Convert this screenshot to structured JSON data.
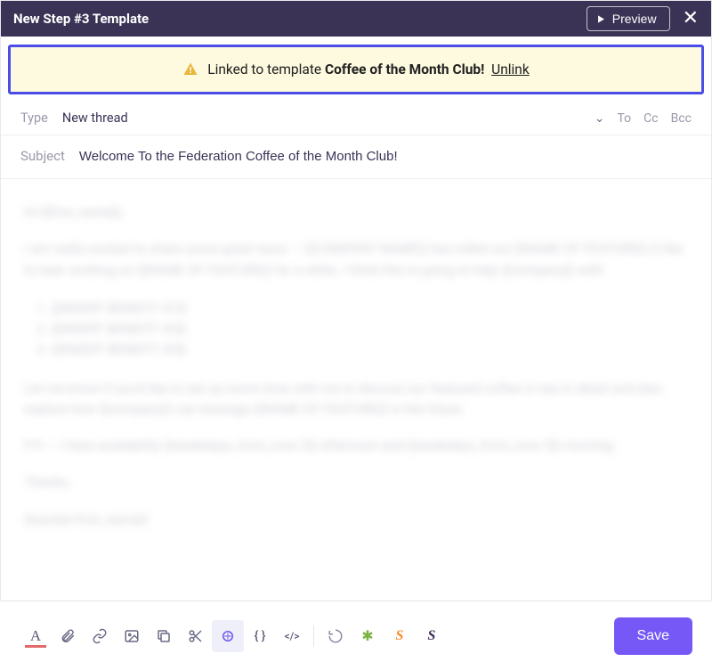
{
  "topbar": {
    "title": "New Step #3 Template",
    "preview": "Preview"
  },
  "alert": {
    "prefix": "Linked to template ",
    "template_name": "Coffee of the Month Club!",
    "unlink": "Unlink"
  },
  "fields": {
    "type_label": "Type",
    "type_value": "New thread",
    "to": "To",
    "cc": "Cc",
    "bcc": "Bcc",
    "subject_label": "Subject",
    "subject_value": "Welcome To the Federation Coffee of the Month Club!"
  },
  "body": {
    "greeting": "Hi {{first_name}},",
    "p1": "I am really excited to share some great news — {{COMPANY NAME}} has rolled out {{NAME OF FEATURE}} (I like to hear working on {{NAME OF FEATURE}} for a while. I think this is going to help {{company}} with:",
    "b1": "{{INSERT BENEFIT #1}}",
    "b2": "{{INSERT BENEFIT #2}}",
    "b3": "{{INSERT BENEFIT #3}}",
    "p2": "Let me know if you'd like to set up some time with me to discuss our featured coffee or tea in detail and also explore how {{company}} can leverage {{NAME OF FEATURE}} in the future.",
    "p3": "FYI — I have availability {{weekdays_from_now 2}} afternoon and {{weekdays_from_now 3}} morning.",
    "thanks": "Thanks,",
    "sig": "{{sender.first_name}}"
  },
  "toolbar": {
    "text_a": "A",
    "braces": "{ }",
    "code": "</>",
    "s1": "S",
    "s2": "S",
    "save": "Save"
  }
}
